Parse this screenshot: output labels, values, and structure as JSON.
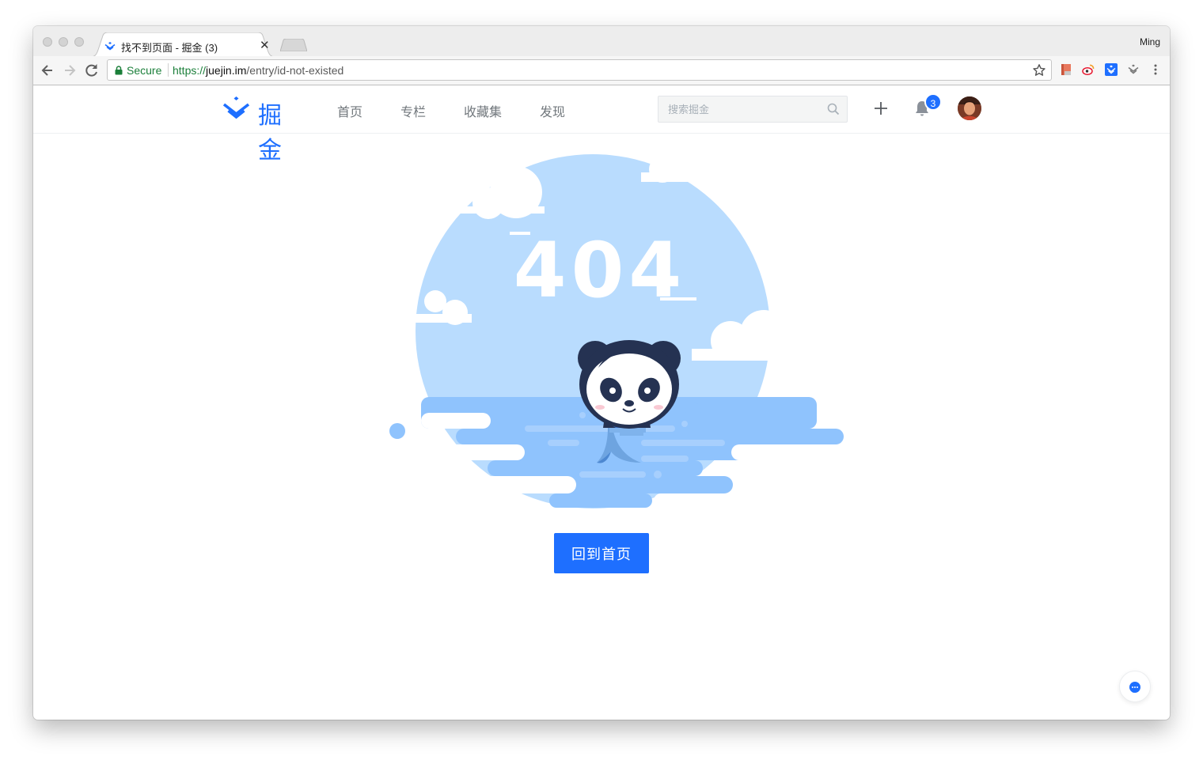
{
  "browser": {
    "tab": {
      "title": "找不到页面 - 掘金 (3)",
      "favicon": "juejin-logo-icon"
    },
    "profile_name": "Ming",
    "security_label": "Secure",
    "url": {
      "scheme": "https://",
      "host": "juejin.im",
      "path": "/entry/id-not-existed"
    },
    "extensions": [
      "bookmark-extension-icon",
      "weibo-extension-icon",
      "juejin-extension-icon",
      "pocket-extension-icon"
    ]
  },
  "site": {
    "logo_text": "掘金",
    "nav": [
      "首页",
      "专栏",
      "收藏集",
      "发现"
    ],
    "search": {
      "placeholder": "搜索掘金",
      "value": ""
    },
    "notifications_count": "3"
  },
  "error": {
    "code": "404",
    "home_button": "回到首页"
  },
  "colors": {
    "brand": "#1e6fff",
    "sky": "#b9dcfe",
    "water": "#8fc3fd",
    "nav_text": "#71777c"
  }
}
